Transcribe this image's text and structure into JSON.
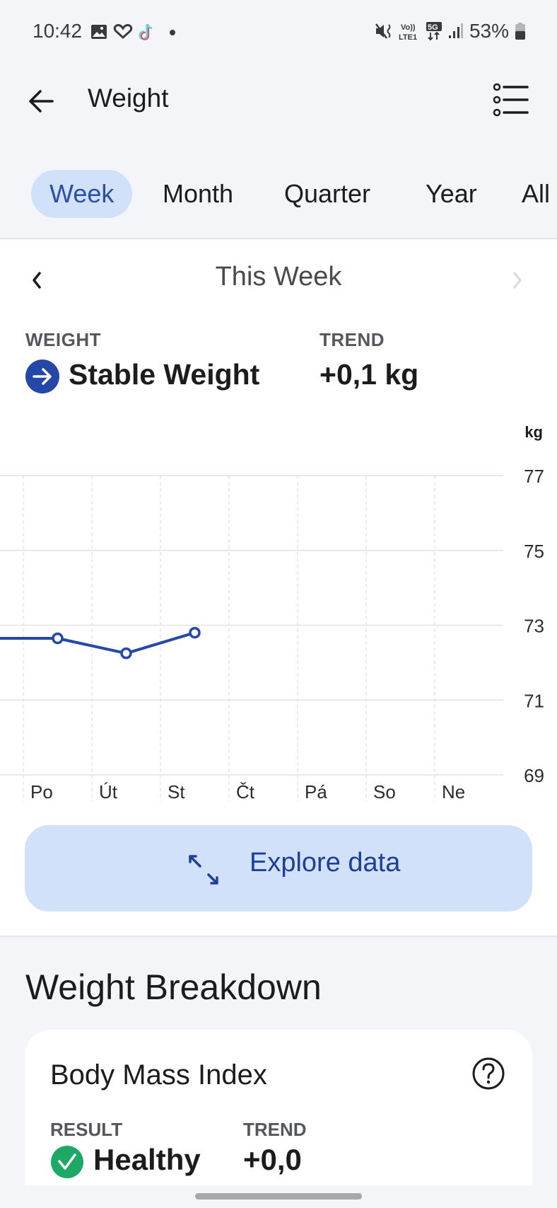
{
  "status_bar": {
    "time": "10:42",
    "left_icons": [
      "gallery-icon",
      "health-heart-icon",
      "tiktok-icon",
      "notification-dot-icon"
    ],
    "right_icons": [
      "mute-vibrate-icon",
      "volte-lte1-icon",
      "5g-data-icon",
      "signal-strength-icon"
    ],
    "network_volte": "Vo)) LTE1",
    "network_5g": "5G",
    "battery_percent": "53%",
    "battery_level": 0.53
  },
  "header": {
    "title": "Weight",
    "back_icon": "arrow-left-icon",
    "menu_icon": "list-menu-icon"
  },
  "tabs": [
    {
      "label": "Week",
      "active": true
    },
    {
      "label": "Month",
      "active": false
    },
    {
      "label": "Quarter",
      "active": false
    },
    {
      "label": "Year",
      "active": false
    },
    {
      "label": "All",
      "active": false
    }
  ],
  "period": {
    "title": "This Week",
    "prev_enabled": true,
    "next_enabled": false
  },
  "summary": {
    "weight_label": "WEIGHT",
    "weight_value": "Stable Weight",
    "weight_icon": "arrow-right-circle-icon",
    "trend_label": "TREND",
    "trend_value": "+0,1 kg"
  },
  "chart_data": {
    "type": "line",
    "title": "",
    "xlabel": "",
    "ylabel": "kg",
    "categories": [
      "Po",
      "Út",
      "St",
      "Čt",
      "Pá",
      "So",
      "Ne"
    ],
    "yticks": [
      77,
      75,
      73,
      71,
      69
    ],
    "ylim": [
      69,
      77
    ],
    "grid": true,
    "series": [
      {
        "name": "Weight",
        "color": "#2447a8",
        "previous_value": 72.65,
        "values": [
          72.65,
          72.25,
          72.8,
          null,
          null,
          null,
          null
        ]
      }
    ]
  },
  "explore": {
    "label": "Explore data",
    "icon": "expand-diagonal-icon"
  },
  "breakdown": {
    "title": "Weight Breakdown",
    "bmi_card": {
      "title": "Body Mass Index",
      "help_icon": "question-circle-icon",
      "result_label": "RESULT",
      "result_value": "Healthy",
      "result_icon": "check-circle-icon",
      "trend_label": "TREND",
      "trend_value": "+0,0"
    }
  },
  "colors": {
    "accent": "#2447a8",
    "accent_light": "#d1e1fa",
    "healthy": "#1ea866",
    "background": "#f4f5f9"
  }
}
